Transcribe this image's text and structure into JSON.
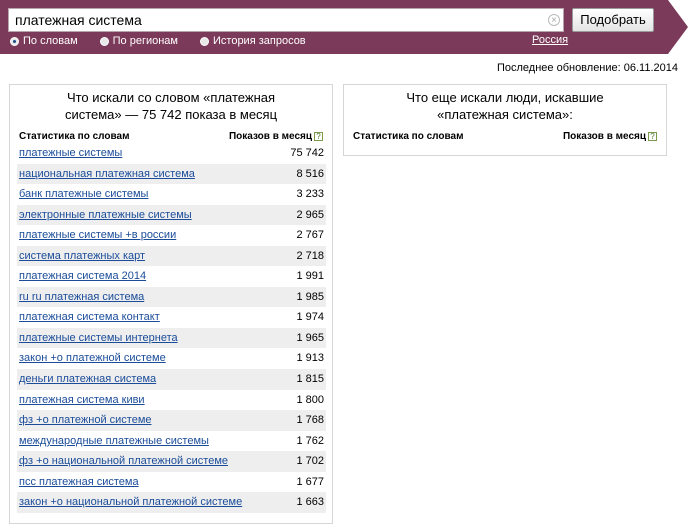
{
  "search": {
    "query": "платежная система",
    "button_label": "Подобрать",
    "clear_icon": "close-circle-icon"
  },
  "modes": [
    {
      "label": "По словам",
      "selected": true
    },
    {
      "label": "По регионам",
      "selected": false
    },
    {
      "label": "История запросов",
      "selected": false
    }
  ],
  "region": "Россия",
  "last_update": "Последнее обновление: 06.11.2014",
  "left_panel": {
    "title": "Что искали со словом «платежная система» — 75 742 показа в месяц",
    "col_keyword": "Статистика по словам",
    "col_count": "Показов в месяц",
    "help_icon": "?",
    "rows": [
      {
        "keyword": "платежные системы",
        "count": "75 742"
      },
      {
        "keyword": "национальная платежная система",
        "count": "8 516"
      },
      {
        "keyword": "банк платежные системы",
        "count": "3 233"
      },
      {
        "keyword": "электронные платежные системы",
        "count": "2 965"
      },
      {
        "keyword": "платежные системы +в россии",
        "count": "2 767"
      },
      {
        "keyword": "система платежных карт",
        "count": "2 718"
      },
      {
        "keyword": "платежная система 2014",
        "count": "1 991"
      },
      {
        "keyword": "ru ru платежная система",
        "count": "1 985"
      },
      {
        "keyword": "платежная система контакт",
        "count": "1 974"
      },
      {
        "keyword": "платежные системы интернета",
        "count": "1 965"
      },
      {
        "keyword": "закон +о платежной системе",
        "count": "1 913"
      },
      {
        "keyword": "деньги платежная система",
        "count": "1 815"
      },
      {
        "keyword": "платежная система киви",
        "count": "1 800"
      },
      {
        "keyword": "фз +о платежной системе",
        "count": "1 768"
      },
      {
        "keyword": "международные платежные системы",
        "count": "1 762"
      },
      {
        "keyword": "фз +о национальной платежной системе",
        "count": "1 702"
      },
      {
        "keyword": "псс платежная система",
        "count": "1 677"
      },
      {
        "keyword": "закон +о национальной платежной системе",
        "count": "1 663"
      }
    ]
  },
  "right_panel": {
    "title": "Что еще искали люди, искавшие «платежная система»:",
    "col_keyword": "Статистика по словам",
    "col_count": "Показов в месяц",
    "help_icon": "?"
  }
}
